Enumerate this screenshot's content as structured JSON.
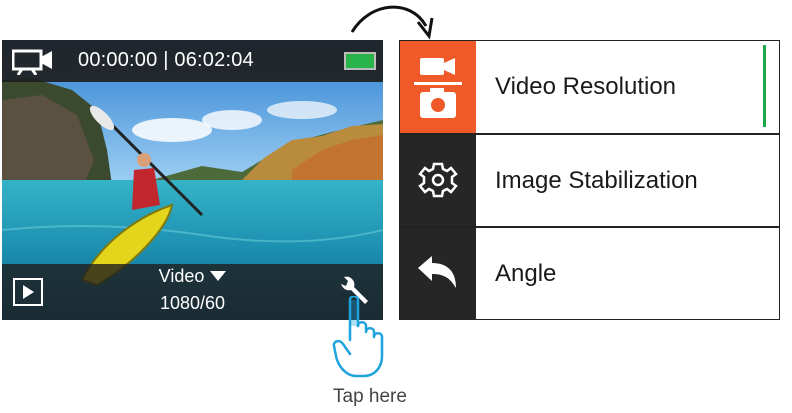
{
  "camera": {
    "time_elapsed": "00:00:00",
    "time_separator": "|",
    "time_remaining": "06:02:04",
    "mode_label": "Video",
    "resolution_label": "1080/60",
    "battery_color": "#28b34b",
    "icons": [
      "video-camera-icon",
      "battery-icon",
      "playback-icon",
      "wrench-icon",
      "dropdown-arrow-icon"
    ]
  },
  "menu": {
    "items": [
      {
        "label": "Video Resolution",
        "icon": "video-photo-mode-icon",
        "selected": true
      },
      {
        "label": "Image Stabilization",
        "icon": "gear-icon",
        "selected": false
      },
      {
        "label": "Angle",
        "icon": "back-arrow-icon",
        "selected": false
      }
    ],
    "accent_color": "#f05a28",
    "scroll_color": "#1fa64a"
  },
  "hint": {
    "label": "Tap here",
    "icon": "tap-hand-icon",
    "color": "#1ea3dc"
  }
}
